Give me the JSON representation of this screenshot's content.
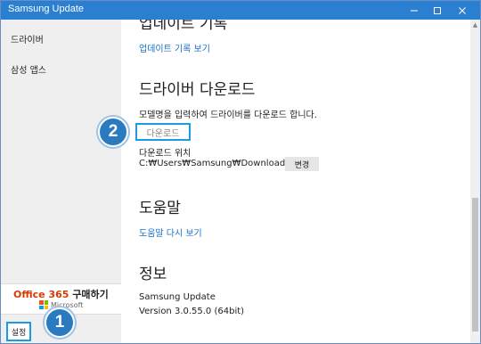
{
  "window": {
    "title": "Samsung Update",
    "minimize_icon": "minimize-icon",
    "maximize_icon": "maximize-icon",
    "close_icon": "close-icon",
    "title_bar_color": "#2b7fd1"
  },
  "sidebar": {
    "items": [
      {
        "label": "드라이버"
      },
      {
        "label": "삼성 앱스"
      }
    ],
    "settings_label": "설정"
  },
  "office_ad": {
    "brand": "Office 365",
    "action": "구매하기",
    "vendor": "Microsoft",
    "brand_color": "#d83b01"
  },
  "main": {
    "update_history": {
      "heading": "업데이트 기록",
      "link": "업데이트 기록 보기"
    },
    "driver_download": {
      "heading": "드라이버 다운로드",
      "description": "모델명을 입력하여 드라이버를 다운로드 합니다.",
      "download_button": "다운로드",
      "location_label": "다운로드 위치",
      "location_path": "C:₩Users₩Samsung₩Downloads",
      "change_button": "변경"
    },
    "help": {
      "heading": "도움말",
      "link": "도움말 다시 보기"
    },
    "info": {
      "heading": "정보",
      "app_name": "Samsung Update",
      "version": "Version 3.0.55.0 (64bit)"
    }
  },
  "annotations": {
    "badge_1": "1",
    "badge_2": "2",
    "highlight_color": "#1a9be6",
    "badge_color": "#2a7abf"
  },
  "link_color": "#1a73c7"
}
